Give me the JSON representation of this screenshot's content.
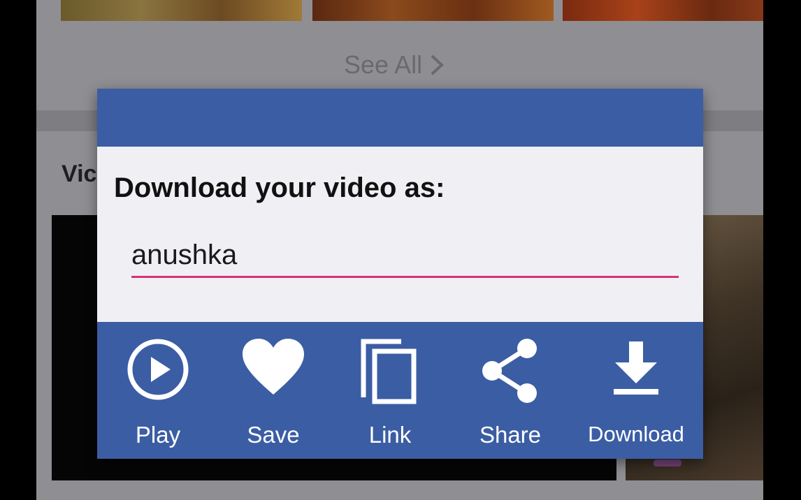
{
  "background": {
    "see_all_label": "See All",
    "section_title": "Vic"
  },
  "dialog": {
    "title": "Download your video as:",
    "filename_value": "anushka",
    "accent_color": "#3b5da4",
    "input_underline_color": "#d6317a",
    "actions": [
      {
        "label": "Play",
        "icon": "play-circle-icon"
      },
      {
        "label": "Save",
        "icon": "heart-icon"
      },
      {
        "label": "Link",
        "icon": "copy-icon"
      },
      {
        "label": "Share",
        "icon": "share-icon"
      },
      {
        "label": "Download",
        "icon": "download-icon"
      }
    ]
  }
}
